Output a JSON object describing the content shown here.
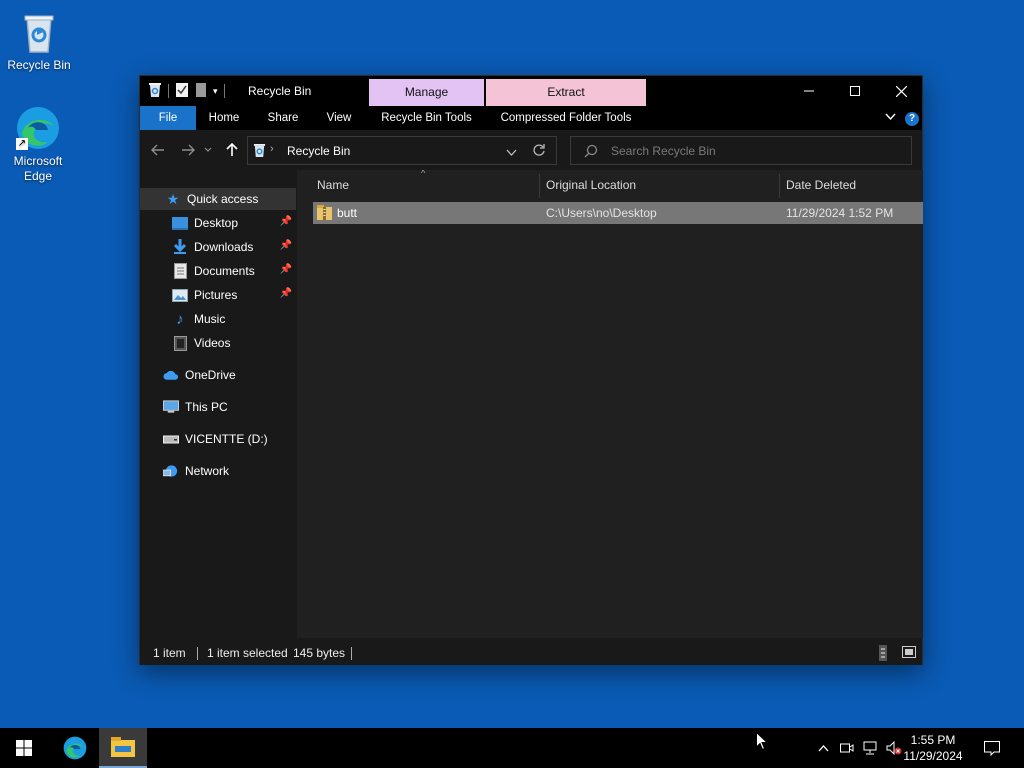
{
  "desktop": {
    "icons": [
      {
        "label": "Recycle Bin",
        "icon": "recycle-bin-icon"
      },
      {
        "label_line1": "Microsoft",
        "label_line2": "Edge",
        "icon": "edge-icon"
      }
    ]
  },
  "window": {
    "title": "Recycle Bin",
    "context_tabs": {
      "manage": "Manage",
      "extract": "Extract",
      "manage_color": "#e2c3f4",
      "extract_color": "#f4c3d5"
    },
    "ribbon": {
      "tabs": [
        "File",
        "Home",
        "Share",
        "View",
        "Recycle Bin Tools",
        "Compressed Folder Tools"
      ],
      "help_icon": "help-icon"
    },
    "address": {
      "path": "Recycle Bin",
      "search_placeholder": "Search Recycle Bin"
    },
    "nav": {
      "quick_access": "Quick access",
      "items": [
        "Desktop",
        "Downloads",
        "Documents",
        "Pictures",
        "Music",
        "Videos"
      ],
      "onedrive": "OneDrive",
      "this_pc": "This PC",
      "drive": "VICENTTE (D:)",
      "network": "Network"
    },
    "columns": {
      "name": "Name",
      "location": "Original Location",
      "date": "Date Deleted"
    },
    "files": [
      {
        "name": "butt",
        "location": "C:\\Users\\no\\Desktop",
        "date": "11/29/2024 1:52 PM"
      }
    ],
    "status": {
      "count": "1 item",
      "selected": "1 item selected",
      "size": "145 bytes"
    }
  },
  "taskbar": {
    "time": "1:55 PM",
    "date": "11/29/2024"
  },
  "colors": {
    "desktop": "#0a5bb5",
    "accent": "#1a73c9"
  }
}
